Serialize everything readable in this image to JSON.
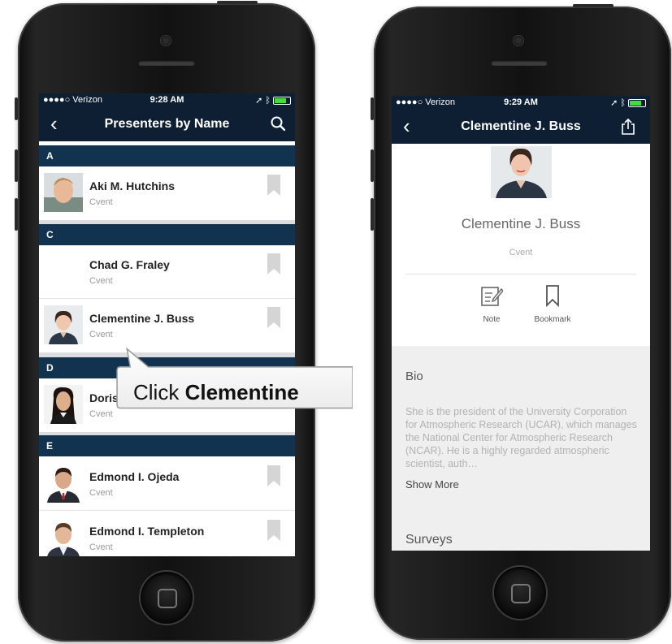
{
  "left_screen": {
    "status": {
      "carrier": "●●●●○ Verizon",
      "time": "9:28 AM"
    },
    "nav": {
      "title": "Presenters by Name"
    },
    "sections": [
      {
        "letter": "A"
      },
      {
        "letter": "C"
      },
      {
        "letter": "D"
      },
      {
        "letter": "E"
      }
    ],
    "presenters": [
      {
        "name": "Aki M. Hutchins",
        "org": "Cvent"
      },
      {
        "name": "Chad G. Fraley",
        "org": "Cvent"
      },
      {
        "name": "Clementine J. Buss",
        "org": "Cvent"
      },
      {
        "name": "Doris",
        "org": "Cvent"
      },
      {
        "name": "Edmond I. Ojeda",
        "org": "Cvent"
      },
      {
        "name": "Edmond I. Templeton",
        "org": "Cvent"
      }
    ]
  },
  "callout": {
    "prefix": "Click ",
    "emphasis": "Clementine"
  },
  "right_screen": {
    "status": {
      "carrier": "●●●●○ Verizon",
      "time": "9:29 AM"
    },
    "nav": {
      "title": "Clementine J. Buss"
    },
    "profile": {
      "name": "Clementine J. Buss",
      "org": "Cvent"
    },
    "actions": [
      {
        "label": "Note",
        "icon": "note-icon"
      },
      {
        "label": "Bookmark",
        "icon": "bookmark-icon"
      }
    ],
    "bio": {
      "title": "Bio",
      "text": "She is the president of the University Corporation for Atmospheric Research (UCAR), which manages the National Center for Atmospheric Research (NCAR). He is a highly regarded atmospheric scientist, auth…",
      "show_more": "Show More"
    },
    "surveys_title": "Surveys"
  }
}
